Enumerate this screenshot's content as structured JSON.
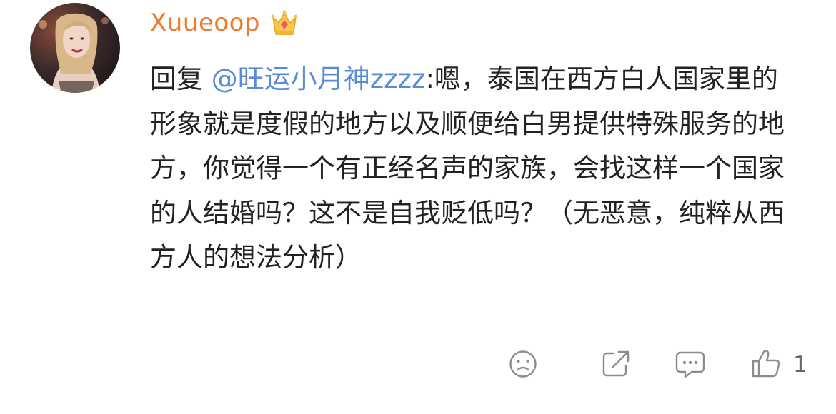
{
  "comment": {
    "username": "Xuueoop",
    "reply_prefix": "回复",
    "mention": "@旺运小月神zzzz",
    "text": ":嗯，泰国在西方白人国家里的形象就是度假的地方以及顺便给白男提供特殊服务的地方，你觉得一个有正经名声的家族，会找这样一个国家的人结婚吗？这不是自我贬低吗？（无恶意，纯粹从西方人的想法分析）"
  },
  "icons": {
    "avatar": "avatar-photo",
    "badge": "crown-icon",
    "dislike": "frown-face-icon",
    "share": "share-icon",
    "reply": "comment-bubble-icon",
    "like": "thumbs-up-icon"
  },
  "actions": {
    "like_count": "1"
  },
  "colors": {
    "username": "#ee7b2b",
    "mention": "#5a8bd6",
    "text": "#222222",
    "icon": "#8c8c8c"
  }
}
